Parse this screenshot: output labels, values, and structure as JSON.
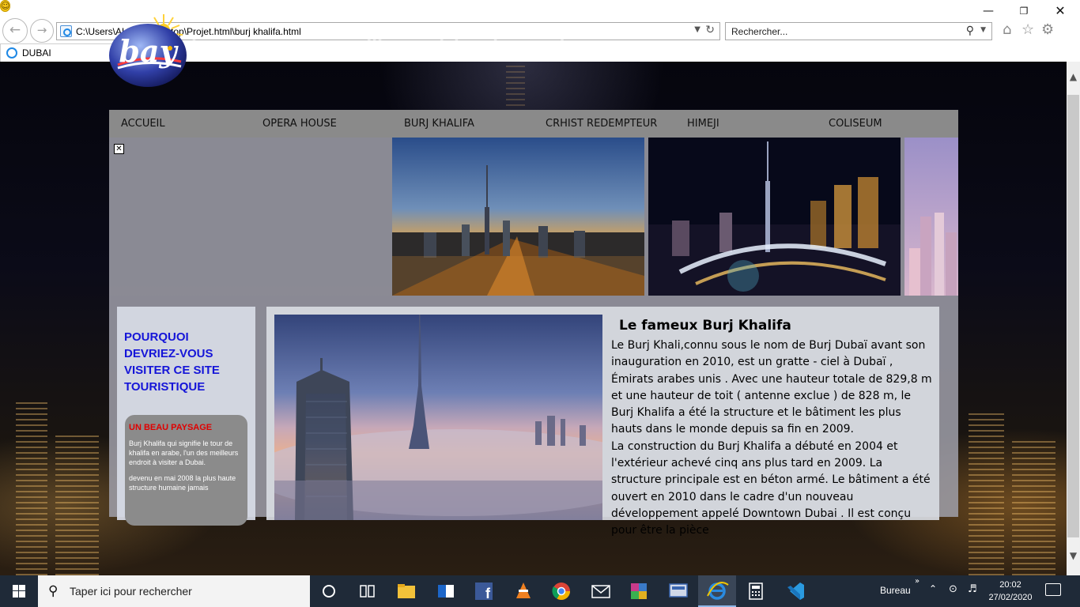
{
  "browser": {
    "address": "C:\\Users\\ALPHA\\Desktop\\Projet.html\\burj khalifa.html",
    "search_placeholder": "Rechercher...",
    "tab_title": "DUBAI"
  },
  "site": {
    "logo_text": "bay",
    "title": "bay-voyage-une meilleure vision du monde"
  },
  "menu": [
    "ACCUEIL",
    "OPERA HOUSE",
    "BURJ KHALIFA",
    "CRHIST REDEMPTEUR",
    "HIMEJI",
    "COLISEUM"
  ],
  "sidebar": {
    "heading": "POURQUOI DEVRIEZ-VOUS VISITER CE SITE TOURISTIQUE",
    "card_title": "UN BEAU PAYSAGE",
    "card_text_1": "Burj Khalifa qui signifie le tour de khalifa en arabe, l'un des meilleurs endroit à visiter a Dubai.",
    "card_text_2": "devenu en mai 2008 la plus haute structure humaine jamais"
  },
  "article": {
    "title": "Le fameux Burj Khalifa",
    "paragraph_1": "Le Burj Khali,connu sous le nom de Burj Dubaï avant son inauguration en 2010, est un gratte - ciel à Dubaï , Émirats arabes unis . Avec une hauteur totale de 829,8 m et une hauteur de toit ( antenne exclue ) de 828 m, le Burj Khalifa a été la structure et le bâtiment les plus hauts dans le monde depuis sa fin en 2009.",
    "paragraph_2": "La construction du Burj Khalifa a débuté en 2004 et l'extérieur achevé cinq ans plus tard en 2009. La structure principale est en béton armé. Le bâtiment a été ouvert en 2010 dans le cadre d'un nouveau développement appelé Downtown Dubai . Il est conçu pour être la pièce"
  },
  "taskbar": {
    "search_placeholder": "Taper ici pour rechercher",
    "tray_label": "Bureau",
    "time": "20:02",
    "date": "27/02/2020",
    "apps": [
      "task-view",
      "file-explorer",
      "outlook",
      "facebook",
      "vlc",
      "chrome",
      "mail",
      "winrar",
      "network-app",
      "internet-explorer",
      "calculator",
      "visual-studio-code"
    ]
  }
}
